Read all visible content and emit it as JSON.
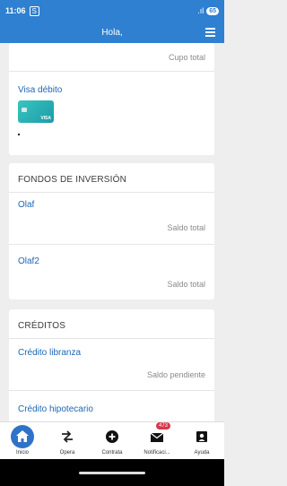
{
  "status_bar": {
    "time": "11:06",
    "notification_icon": "S",
    "signal": ".ıl",
    "battery": "65"
  },
  "app_bar": {
    "title": "Hola,",
    "menu_icon": "hamburger-menu-icon"
  },
  "cards": {
    "card1": {
      "top_label": "Cupo total",
      "visa_link": "Visa débito",
      "card_brand": "VISA",
      "card_colors": [
        "#37c6c0",
        "#1e9aa8"
      ]
    },
    "funds": {
      "title": "FONDOS DE INVERSIÓN",
      "items": [
        {
          "name": "Olaf",
          "label": "Saldo total"
        },
        {
          "name": "Olaf2",
          "label": "Saldo total"
        }
      ]
    },
    "credits": {
      "title": "CRÉDITOS",
      "items": [
        {
          "name": "Crédito libranza",
          "label": "Saldo pendiente"
        },
        {
          "name": "Crédito hipotecario",
          "label": ""
        }
      ]
    }
  },
  "bottom_nav": {
    "items": [
      {
        "label": "Inicio",
        "icon": "home-icon"
      },
      {
        "label": "Opera",
        "icon": "transfer-arrows-icon"
      },
      {
        "label": "Contrata",
        "icon": "add-circle-icon"
      },
      {
        "label": "Notificaci...",
        "icon": "mail-icon",
        "badge": "473"
      },
      {
        "label": "Ayuda",
        "icon": "person-help-icon"
      }
    ],
    "active_color": "#2f73c9"
  },
  "colors": {
    "primary": "#2f80d1",
    "link": "#1d66b5",
    "badge": "#d9374b"
  }
}
